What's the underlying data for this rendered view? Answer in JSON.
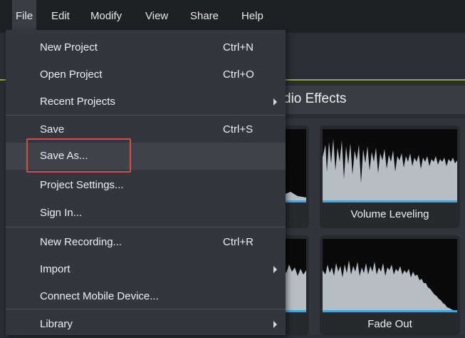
{
  "menubar": {
    "items": [
      {
        "label": "File",
        "active": true
      },
      {
        "label": "Edit"
      },
      {
        "label": "Modify"
      },
      {
        "label": "View"
      },
      {
        "label": "Share"
      },
      {
        "label": "Help"
      }
    ]
  },
  "panel": {
    "title": "Audio Effects",
    "title_visible_fragment": "dio Effects",
    "tiles": [
      {
        "label": "Volume Leveling"
      },
      {
        "label": "Fade Out"
      }
    ]
  },
  "file_menu": {
    "items": [
      {
        "label": "New Project",
        "shortcut": "Ctrl+N"
      },
      {
        "label": "Open Project",
        "shortcut": "Ctrl+O"
      },
      {
        "label": "Recent Projects",
        "submenu": true
      },
      {
        "label": "Save",
        "shortcut": "Ctrl+S"
      },
      {
        "label": "Save As...",
        "highlighted": true
      },
      {
        "label": "Project Settings..."
      },
      {
        "label": "Sign In..."
      },
      {
        "label": "New Recording...",
        "shortcut": "Ctrl+R"
      },
      {
        "label": "Import",
        "submenu": true
      },
      {
        "label": "Connect Mobile Device..."
      },
      {
        "label": "Library",
        "submenu": true
      }
    ]
  },
  "colors": {
    "accent_line": "#8fa63a",
    "highlight_border": "#e04848",
    "wave_fill": "#b7bec3",
    "wave_underline": "#3aa7e4"
  }
}
